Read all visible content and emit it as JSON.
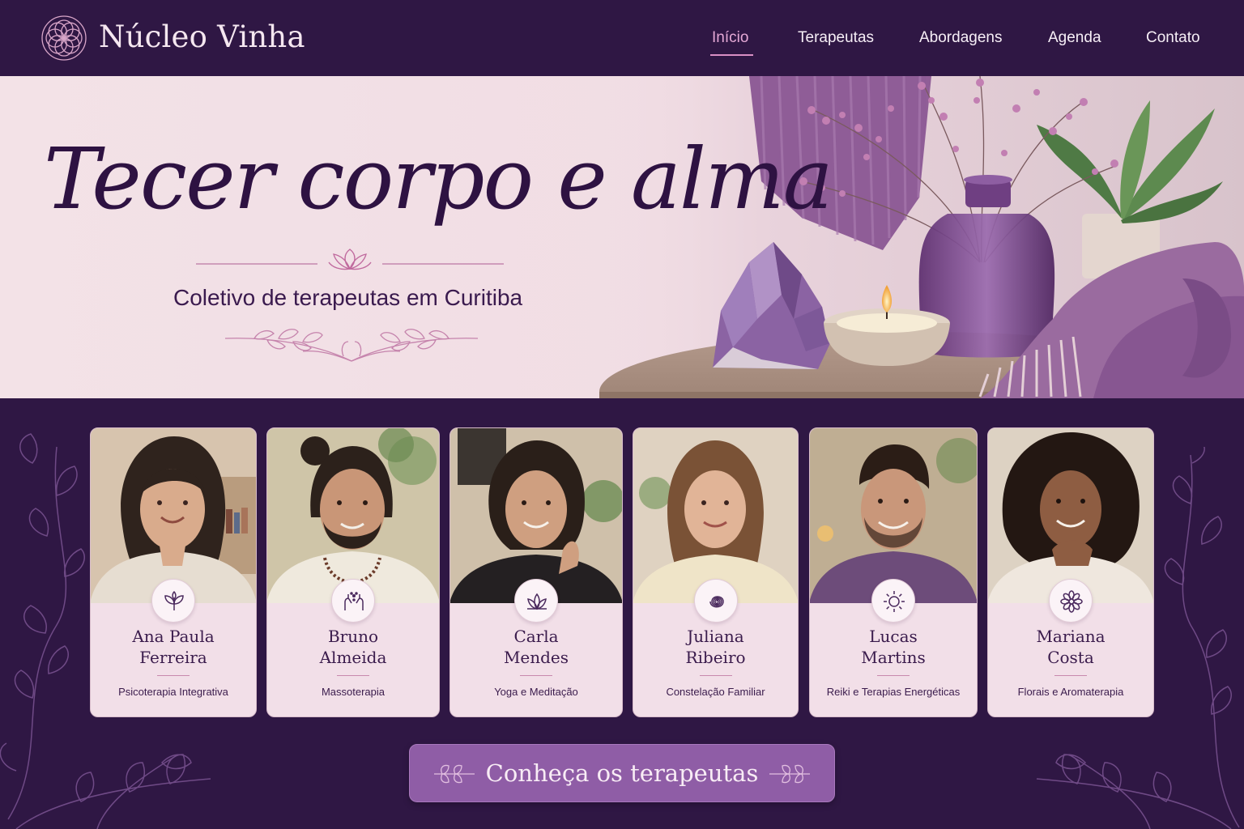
{
  "brand": {
    "name": "Núcleo Vinha",
    "logo_icon": "mandala-logo-icon"
  },
  "nav": {
    "items": [
      {
        "label": "Início",
        "active": true
      },
      {
        "label": "Terapeutas",
        "active": false
      },
      {
        "label": "Abordagens",
        "active": false
      },
      {
        "label": "Agenda",
        "active": false
      },
      {
        "label": "Contato",
        "active": false
      }
    ]
  },
  "hero": {
    "title": "Tecer corpo e alma",
    "subtitle": "Coletivo de terapeutas em Curitiba",
    "divider_icon": "lotus-icon",
    "ornament_icon": "laurel-branch-icon"
  },
  "therapists": [
    {
      "first": "Ana Paula",
      "last": "Ferreira",
      "specialty": "Psicoterapia Integrativa",
      "icon": "sprout-icon"
    },
    {
      "first": "Bruno",
      "last": "Almeida",
      "specialty": "Massoterapia",
      "icon": "healing-hands-icon"
    },
    {
      "first": "Carla",
      "last": "Mendes",
      "specialty": "Yoga e Meditação",
      "icon": "lotus-icon"
    },
    {
      "first": "Juliana",
      "last": "Ribeiro",
      "specialty": "Constelação Familiar",
      "icon": "spiral-icon"
    },
    {
      "first": "Lucas",
      "last": "Martins",
      "specialty": "Reiki e Terapias Energéticas",
      "icon": "sun-icon"
    },
    {
      "first": "Mariana",
      "last": "Costa",
      "specialty": "Florais e Aromaterapia",
      "icon": "flower-icon"
    }
  ],
  "cta": {
    "label": "Conheça os terapeutas"
  },
  "colors": {
    "background": "#2f1744",
    "accent": "#8f5da6",
    "nav_active": "#e5a9d6",
    "card": "#f2dfe8",
    "hero_bg": "#f3e2e7"
  }
}
